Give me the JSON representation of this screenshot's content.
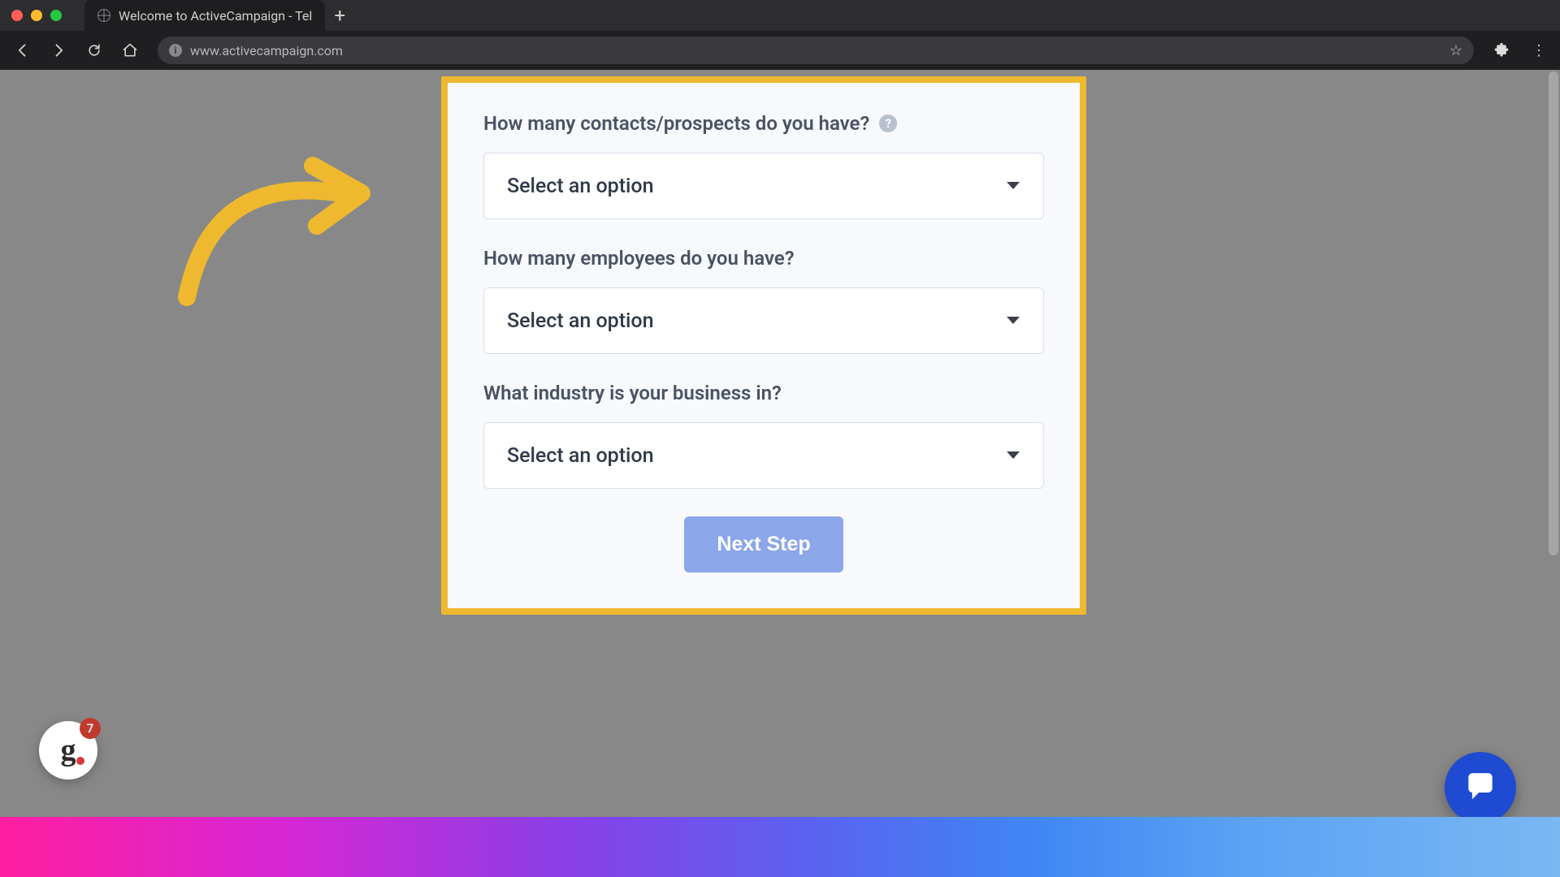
{
  "browser": {
    "tab_title": "Welcome to ActiveCampaign - Tel",
    "url": "www.activecampaign.com"
  },
  "form": {
    "fields": [
      {
        "label": "How many contacts/prospects do you have?",
        "placeholder": "Select an option",
        "has_help": true
      },
      {
        "label": "How many employees do you have?",
        "placeholder": "Select an option",
        "has_help": false
      },
      {
        "label": "What industry is your business in?",
        "placeholder": "Select an option",
        "has_help": false
      }
    ],
    "submit_label": "Next Step"
  },
  "left_widget": {
    "badge_count": "7",
    "logo_text": "g"
  },
  "colors": {
    "highlight_border": "#eeb92f",
    "button": "#8ba6e9",
    "chat_fab": "#1e4bd1",
    "badge": "#c0392b"
  }
}
